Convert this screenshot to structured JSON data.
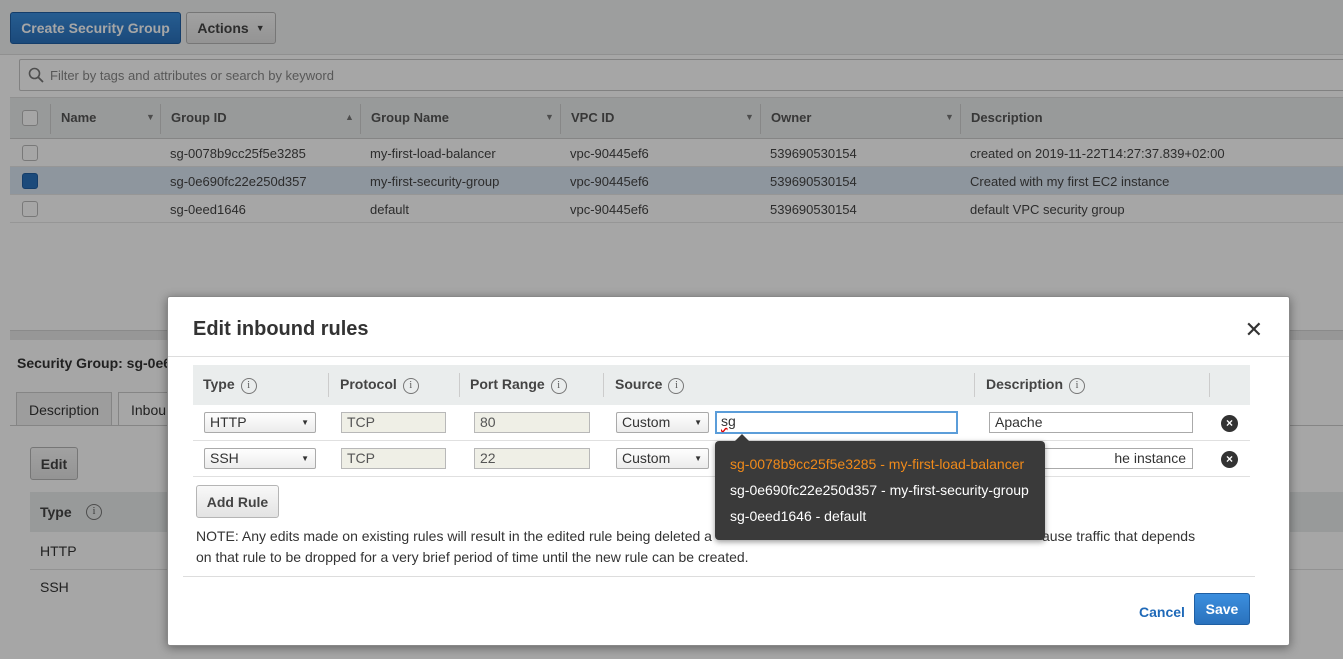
{
  "toolbar": {
    "create_label": "Create Security Group",
    "actions_label": "Actions",
    "search_placeholder": "Filter by tags and attributes or search by keyword"
  },
  "table": {
    "columns": [
      "Name",
      "Group ID",
      "Group Name",
      "VPC ID",
      "Owner",
      "Description"
    ],
    "rows": [
      {
        "name": "",
        "group_id": "sg-0078b9cc25f5e3285",
        "group_name": "my-first-load-balancer",
        "vpc_id": "vpc-90445ef6",
        "owner": "539690530154",
        "description": "created on 2019-11-22T14:27:37.839+02:00",
        "selected": false
      },
      {
        "name": "",
        "group_id": "sg-0e690fc22e250d357",
        "group_name": "my-first-security-group",
        "vpc_id": "vpc-90445ef6",
        "owner": "539690530154",
        "description": "Created with my first EC2 instance",
        "selected": true
      },
      {
        "name": "",
        "group_id": "sg-0eed1646",
        "group_name": "default",
        "vpc_id": "vpc-90445ef6",
        "owner": "539690530154",
        "description": "default VPC security group",
        "selected": false
      }
    ]
  },
  "detail": {
    "title": "Security Group: sg-0e6",
    "tabs": [
      "Description",
      "Inbou"
    ],
    "edit_label": "Edit",
    "type_header": "Type",
    "types": [
      "HTTP",
      "SSH"
    ]
  },
  "modal": {
    "title": "Edit inbound rules",
    "close_icon": "✕",
    "headers": {
      "type": "Type",
      "protocol": "Protocol",
      "port_range": "Port Range",
      "source": "Source",
      "description": "Description"
    },
    "rules": [
      {
        "type": "HTTP",
        "protocol": "TCP",
        "port": "80",
        "source_type": "Custom",
        "source_value": "sg",
        "description": "Apache"
      },
      {
        "type": "SSH",
        "protocol": "TCP",
        "port": "22",
        "source_type": "Custom",
        "source_value": "",
        "description": "he instance"
      }
    ],
    "add_rule_label": "Add Rule",
    "note_line1": "NOTE: Any edits made on existing rules will result in the edited rule being deleted a",
    "note_line1_end": "ause traffic that depends",
    "note_line2": "on that rule to be dropped for a very brief period of time until the new rule can be created.",
    "cancel_label": "Cancel",
    "save_label": "Save"
  },
  "autocomplete": {
    "options": [
      "sg-0078b9cc25f5e3285 - my-first-load-balancer",
      "sg-0e690fc22e250d357 - my-first-security-group",
      "sg-0eed1646 - default"
    ],
    "active_color": "#f08a1a"
  },
  "colors": {
    "primary": "#2a72bd",
    "link": "#1f69b8",
    "selected_row": "#dbe6f3"
  }
}
